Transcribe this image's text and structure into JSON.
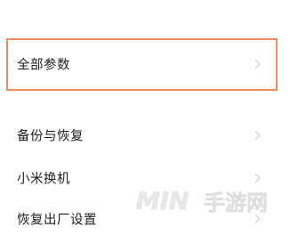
{
  "settings": {
    "items": [
      {
        "label": "全部参数",
        "highlighted": true
      },
      {
        "label": "备份与恢复"
      },
      {
        "label": "小米换机"
      },
      {
        "label": "恢复出厂设置"
      }
    ],
    "highlight_color": "#f08a5d",
    "chevron_icon": "chevron-right-icon"
  },
  "watermark": {
    "text_latin": "MIN",
    "text_cjk": "手游网"
  }
}
